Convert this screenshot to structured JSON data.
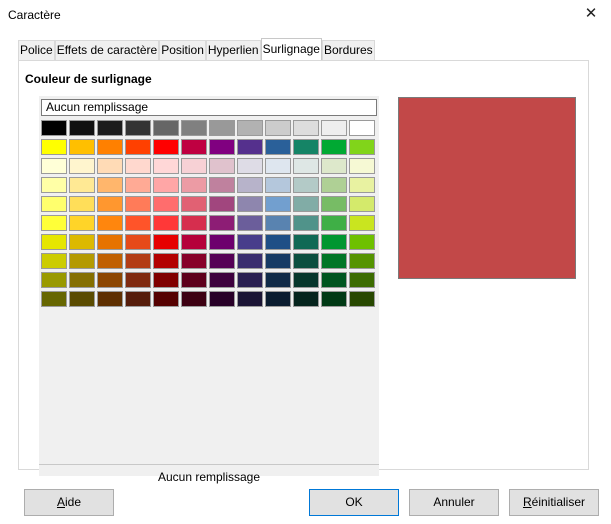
{
  "window": {
    "title": "Caractère",
    "close_glyph": "✕"
  },
  "tabs": [
    {
      "label": "Police"
    },
    {
      "label": "Effets de caractère"
    },
    {
      "label": "Position"
    },
    {
      "label": "Hyperlien"
    },
    {
      "label": "Surlignage",
      "active": true
    },
    {
      "label": "Bordures"
    }
  ],
  "section": {
    "label": "Couleur de surlignage"
  },
  "palette": {
    "no_fill_button": "Aucun remplissage",
    "current_label": "Aucun remplissage",
    "rows": [
      [
        "#000000",
        "#111111",
        "#1c1c1c",
        "#333333",
        "#666666",
        "#808080",
        "#999999",
        "#b2b2b2",
        "#cccccc",
        "#dddddd",
        "#eeeeee",
        "#ffffff"
      ],
      [
        "#ffff00",
        "#ffbf00",
        "#ff8000",
        "#ff4000",
        "#ff0000",
        "#bf0041",
        "#800080",
        "#55308d",
        "#2a6099",
        "#158466",
        "#00a933",
        "#81d41a"
      ],
      [
        "#ffffd7",
        "#fff5ce",
        "#ffdbb6",
        "#ffd8ce",
        "#ffd7d7",
        "#f7d1d5",
        "#e0c2cd",
        "#dedce6",
        "#dee6ef",
        "#dee7e5",
        "#dde8cb",
        "#f6f9d4"
      ],
      [
        "#ffffa6",
        "#ffe994",
        "#ffb66c",
        "#ffaa95",
        "#ffa6a6",
        "#ec9ba4",
        "#bf819e",
        "#b7b3ca",
        "#b4c7dc",
        "#b3cac7",
        "#afd095",
        "#e8f2a1"
      ],
      [
        "#ffff6d",
        "#ffde59",
        "#ff972f",
        "#ff7b59",
        "#ff6d6d",
        "#e16173",
        "#a1467e",
        "#8e86ae",
        "#729fcf",
        "#81aca6",
        "#77bc65",
        "#d4ea6b"
      ],
      [
        "#ffff38",
        "#ffd428",
        "#ff860d",
        "#ff5429",
        "#ff3838",
        "#d62e4e",
        "#8d1d75",
        "#6b5e9b",
        "#5983b0",
        "#50938a",
        "#3faf46",
        "#c9e51f"
      ],
      [
        "#e6e600",
        "#dcb900",
        "#e67300",
        "#e64a19",
        "#e60000",
        "#b5003a",
        "#6d006d",
        "#483d8b",
        "#1f4f86",
        "#106955",
        "#009630",
        "#6ec000"
      ],
      [
        "#cccc00",
        "#b49a00",
        "#c06000",
        "#b33c14",
        "#b30000",
        "#870029",
        "#550055",
        "#3a2d6f",
        "#173b64",
        "#0b4f3f",
        "#007626",
        "#559400"
      ],
      [
        "#999900",
        "#856f00",
        "#8c4600",
        "#802a0f",
        "#800000",
        "#5e001c",
        "#3d003d",
        "#2a2052",
        "#102a47",
        "#07372c",
        "#005520",
        "#3c6c00"
      ],
      [
        "#666600",
        "#5a4b00",
        "#5e2f00",
        "#551c0a",
        "#550000",
        "#3d0012",
        "#280028",
        "#1b1535",
        "#0a1c30",
        "#05241d",
        "#003915",
        "#284800"
      ]
    ]
  },
  "preview": {
    "color": "#c24848"
  },
  "buttons": {
    "help": {
      "prefix": "",
      "mnemonic": "A",
      "rest": "ide"
    },
    "ok": "OK",
    "cancel": "Annuler",
    "reset": {
      "prefix": "",
      "mnemonic": "R",
      "rest": "éinitialiser"
    }
  }
}
